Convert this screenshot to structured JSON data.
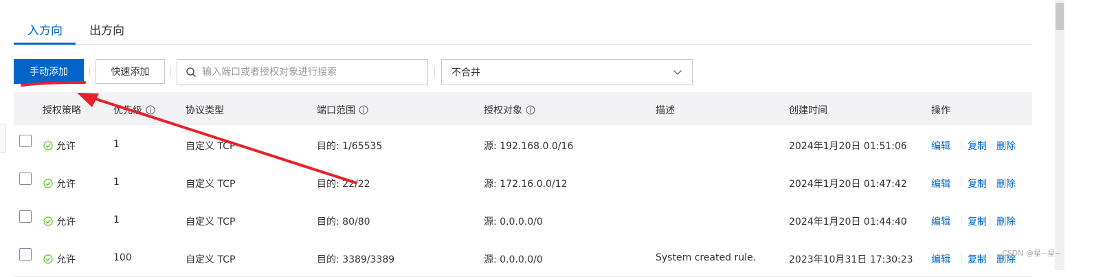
{
  "tabs": [
    {
      "label": "入方向",
      "active": true
    },
    {
      "label": "出方向",
      "active": false
    }
  ],
  "toolbar": {
    "manual_add": "手动添加",
    "quick_add": "快速添加",
    "search_placeholder": "输入端口或者授权对象进行搜索",
    "merge_select": "不合并"
  },
  "table": {
    "headers": {
      "policy": "授权策略",
      "priority": "优先级",
      "protocol": "协议类型",
      "port_range": "端口范围",
      "auth_object": "授权对象",
      "description": "描述",
      "created": "创建时间",
      "actions": "操作"
    },
    "rows": [
      {
        "policy": "允许",
        "priority": "1",
        "protocol": "自定义 TCP",
        "port": "目的: 1/65535",
        "source": "源: 192.168.0.0/16",
        "description": "",
        "created": "2024年1月20日 01:51:06"
      },
      {
        "policy": "允许",
        "priority": "1",
        "protocol": "自定义 TCP",
        "port": "目的: 22/22",
        "source": "源: 172.16.0.0/12",
        "description": "",
        "created": "2024年1月20日 01:47:42"
      },
      {
        "policy": "允许",
        "priority": "1",
        "protocol": "自定义 TCP",
        "port": "目的: 80/80",
        "source": "源: 0.0.0.0/0",
        "description": "",
        "created": "2024年1月20日 01:44:40"
      },
      {
        "policy": "允许",
        "priority": "100",
        "protocol": "自定义 TCP",
        "port": "目的: 3389/3389",
        "source": "源: 0.0.0.0/0",
        "description": "System created rule.",
        "created": "2023年10月31日 17:30:23"
      }
    ],
    "actions": {
      "edit": "编辑",
      "copy": "复制",
      "delete": "删除"
    }
  },
  "watermark": "CSDN @星~星~",
  "colors": {
    "primary": "#0064c8",
    "annotation": "#e8202a",
    "ok_green": "#52c41a"
  }
}
